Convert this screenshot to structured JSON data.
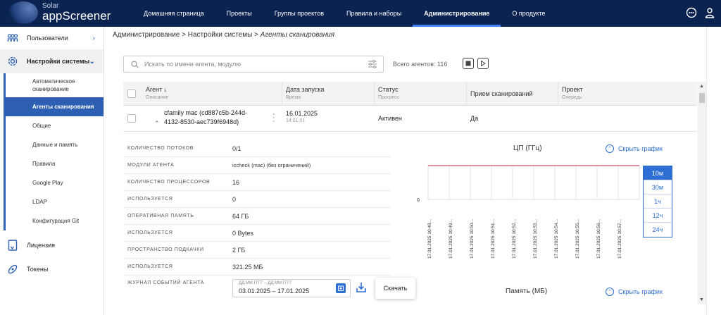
{
  "app": {
    "brand_top": "Solar",
    "brand_name": "appScreener"
  },
  "nav": [
    "Домашняя страница",
    "Проекты",
    "Группы проектов",
    "Правила и наборы",
    "Администрирование",
    "О продукте"
  ],
  "nav_active": "Администрирование",
  "sidebar": {
    "users": "Пользователи",
    "settings": "Настройки системы",
    "sub": [
      "Автоматическое сканирование",
      "Агенты сканирования",
      "Общие",
      "Данные и память",
      "Правила",
      "Google Play",
      "LDAP",
      "Конфигурация Git"
    ],
    "license": "Лицензия",
    "tokens": "Токены"
  },
  "breadcrumb": {
    "part1": "Администрирование",
    "sep": ">",
    "part2": "Настройки системы",
    "current": "Агенты сканирования"
  },
  "search": {
    "placeholder": "Искать по имени агента, модулю"
  },
  "agents_total": "Всего агентов: 116",
  "table": {
    "headers": [
      {
        "label": "Агент ↓",
        "sub": "Описание"
      },
      {
        "label": "Дата запуска",
        "sub": "Время"
      },
      {
        "label": "Статус",
        "sub": "Прогресс"
      },
      {
        "label": "Прием сканирований",
        "sub": ""
      },
      {
        "label": "Проект",
        "sub": "Очередь"
      }
    ],
    "row": {
      "agent_line1": "cfamily mac (cd887c5b-244d-",
      "agent_line2": "4132-8530-aec739f6948d)",
      "date": "16.01.2025",
      "time": "14:01:01",
      "status": "Активен",
      "accept": "Да"
    }
  },
  "details": [
    {
      "key": "Количество потоков",
      "value": "0/1"
    },
    {
      "key": "Модули агента",
      "value": "iccheck (mac) (без ограничений)"
    },
    {
      "key": "Количество процессоров",
      "value": "16"
    },
    {
      "key": "Используется",
      "value": "0"
    },
    {
      "key": "Оперативная память",
      "value": "64 ГБ"
    },
    {
      "key": "Используется",
      "value": "0 Bytes"
    },
    {
      "key": "Пространство подкачки",
      "value": "2 ГБ"
    },
    {
      "key": "Используется",
      "value": "321.25 МБ"
    },
    {
      "key": "Журнал событий агента",
      "value": ""
    }
  ],
  "log": {
    "placeholder": "ДД.ММ.ГГГГ – ДД.ММ.ГГГГ",
    "value": "03.01.2025 – 17.01.2025",
    "download_tooltip": "Скачать"
  },
  "cpu_chart": {
    "title": "ЦП (ГГц)",
    "hide_label": "Скрыть график"
  },
  "mem_chart": {
    "title": "Память (МБ)",
    "hide_label": "Скрыть график"
  },
  "ranges": [
    "10м",
    "30м",
    "1ч",
    "12ч",
    "24ч"
  ],
  "range_active": "10м",
  "colors": {
    "accent": "#2d6fd3",
    "topbar": "#0b2350",
    "cpu_line": "#c9506a"
  },
  "chart_data": {
    "type": "line",
    "title": "ЦП (ГГц)",
    "x": [
      "17.01.2025 10:48...",
      "17.01.2025 10:49...",
      "17.01.2025 10:50...",
      "17.01.2025 10:51...",
      "17.01.2025 10:52...",
      "17.01.2025 10:53...",
      "17.01.2025 10:54...",
      "17.01.2025 10:55...",
      "17.01.2025 10:56...",
      "17.01.2025 10:57..."
    ],
    "series": [
      {
        "values": [
          0,
          0,
          0,
          0,
          0,
          0,
          0,
          0,
          0,
          0
        ]
      }
    ],
    "y_ticks": [
      "0"
    ],
    "grid": true
  }
}
